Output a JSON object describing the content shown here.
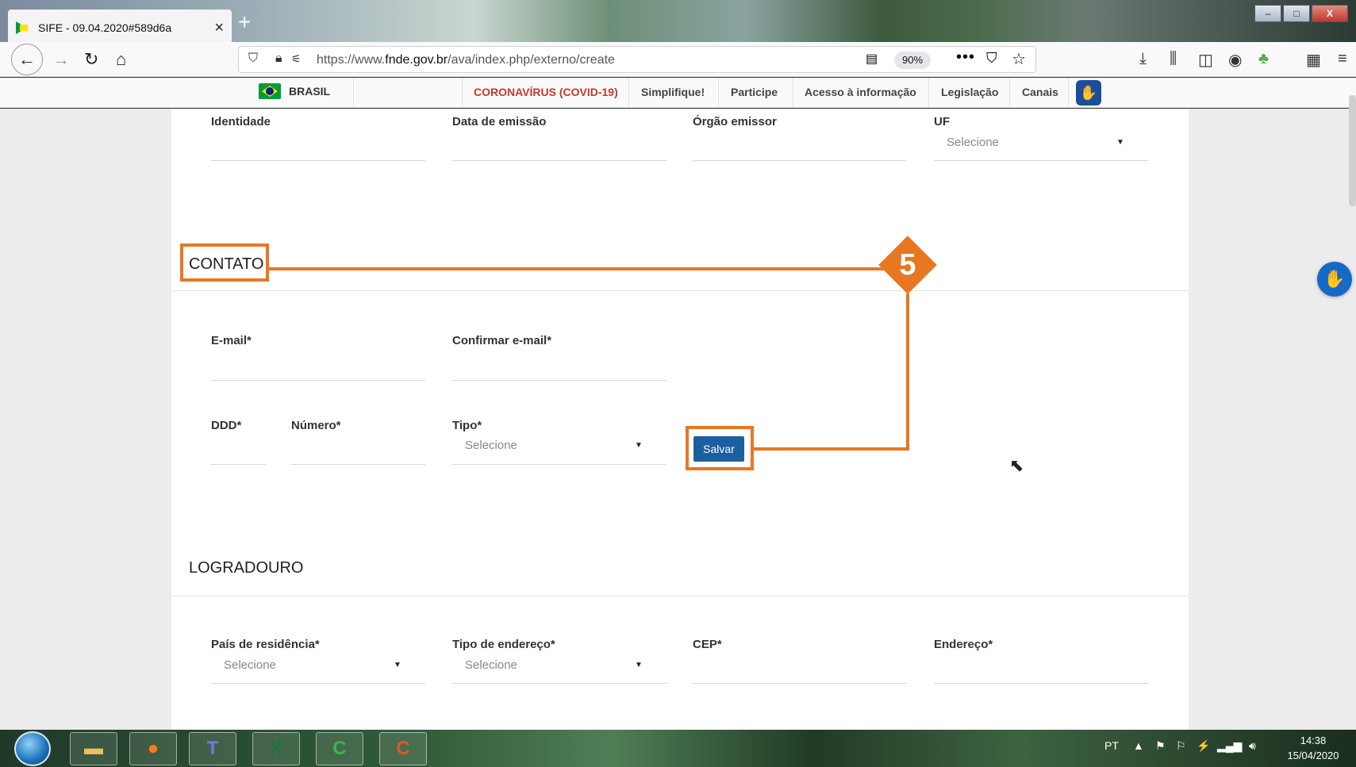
{
  "browser": {
    "tab_title": "SIFE - 09.04.2020#589d6a",
    "tab_close": "×",
    "new_tab": "+",
    "url_prefix": "https://www.",
    "url_domain": "fnde.gov.br",
    "url_path": "/ava/index.php/externo/create",
    "zoom": "90%",
    "more": "•••",
    "window_buttons": [
      "–",
      "□",
      "X"
    ]
  },
  "govbar": {
    "brasil": "BRASIL",
    "links": [
      "CORONAVÍRUS (COVID-19)",
      "Simplifique!",
      "Participe",
      "Acesso à informação",
      "Legislação",
      "Canais"
    ]
  },
  "form": {
    "identidade": {
      "identidade_label": "Identidade",
      "data_emissao_label": "Data de emissão",
      "orgao_emissor_label": "Órgão emissor",
      "uf_label": "UF",
      "uf_value": "Selecione"
    },
    "contato": {
      "title": "CONTATO",
      "email_label": "E-mail*",
      "confirmar_email_label": "Confirmar e-mail*",
      "ddd_label": "DDD*",
      "numero_label": "Número*",
      "tipo_label": "Tipo*",
      "tipo_value": "Selecione",
      "salvar_label": "Salvar"
    },
    "logradouro": {
      "title": "LOGRADOURO",
      "pais_label": "País de residência*",
      "pais_value": "Selecione",
      "tipo_endereco_label": "Tipo de endereço*",
      "tipo_endereco_value": "Selecione",
      "cep_label": "CEP*",
      "endereco_label": "Endereço*"
    }
  },
  "annotation": {
    "step_number": "5",
    "color": "#e87722"
  },
  "taskbar": {
    "language": "PT",
    "time": "14:38",
    "date": "15/04/2020"
  }
}
